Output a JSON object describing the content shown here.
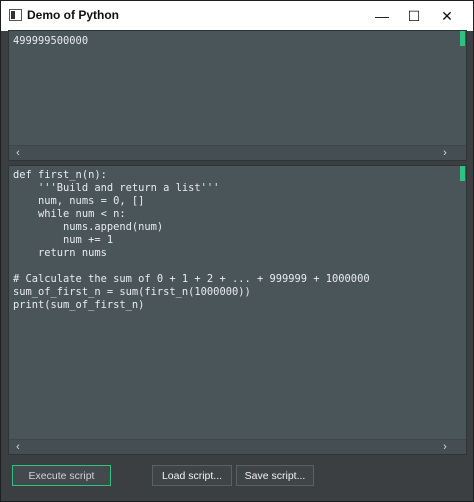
{
  "window": {
    "title": "Demo of Python",
    "minimize_glyph": "—",
    "maximize_glyph": "☐",
    "close_glyph": "✕"
  },
  "output": {
    "text": "499999500000"
  },
  "editor": {
    "code": "def first_n(n):\n    '''Build and return a list'''\n    num, nums = 0, []\n    while num < n:\n        nums.append(num)\n        num += 1\n    return nums\n\n# Calculate the sum of 0 + 1 + 2 + ... + 999999 + 1000000\nsum_of_first_n = sum(first_n(1000000))\nprint(sum_of_first_n)"
  },
  "scroll": {
    "left_glyph": "‹",
    "right_glyph": "›"
  },
  "buttons": {
    "execute": "Execute script",
    "load": "Load script...",
    "save": "Save script..."
  },
  "colors": {
    "accent": "#2ec27e",
    "pane_bg": "#4a555a",
    "window_bg": "#3b3f42"
  }
}
